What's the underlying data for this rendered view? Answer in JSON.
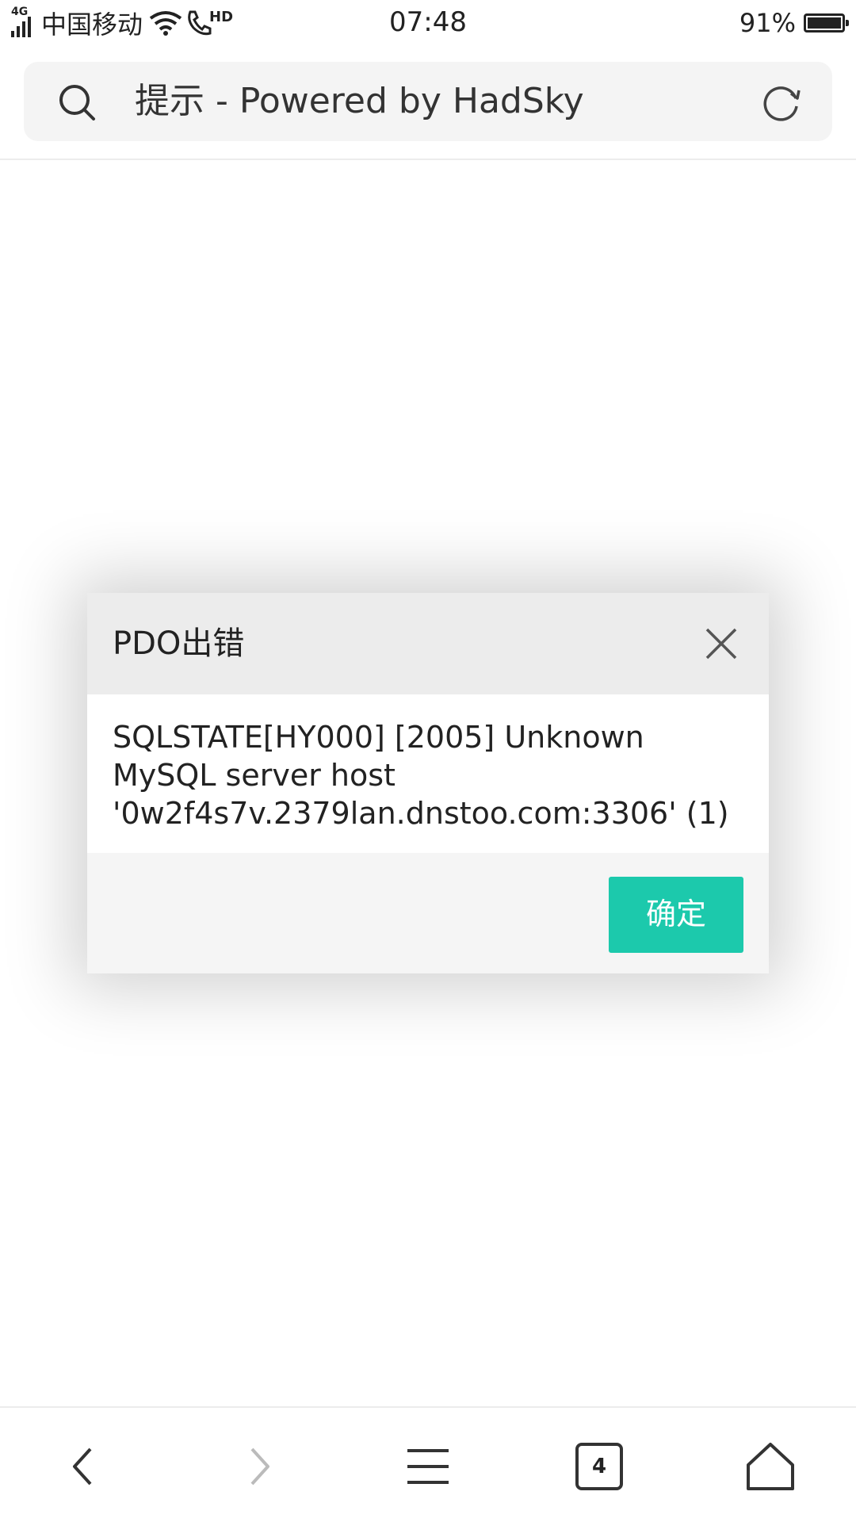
{
  "status_bar": {
    "network": "4G",
    "carrier": "中国移动",
    "hd_label": "HD",
    "time": "07:48",
    "battery_percent_text": "91%",
    "battery_level": 0.91
  },
  "address_bar": {
    "page_title": "提示 - Powered by HadSky",
    "search_icon": "search-icon",
    "reload_icon": "reload-icon"
  },
  "dialog": {
    "title": "PDO出错",
    "message_lines": [
      "SQLSTATE[HY000] [2005] Unknown",
      "MySQL server host",
      "'0w2f4s7v.2379lan.dnstoo.com:3306' (1)"
    ],
    "confirm_label": "确定",
    "confirm_color": "#1cc9ac"
  },
  "bottom_nav": {
    "tabs_count": "4",
    "icons": [
      "back-icon",
      "forward-icon",
      "menu-icon",
      "tabs-icon",
      "home-icon"
    ]
  }
}
